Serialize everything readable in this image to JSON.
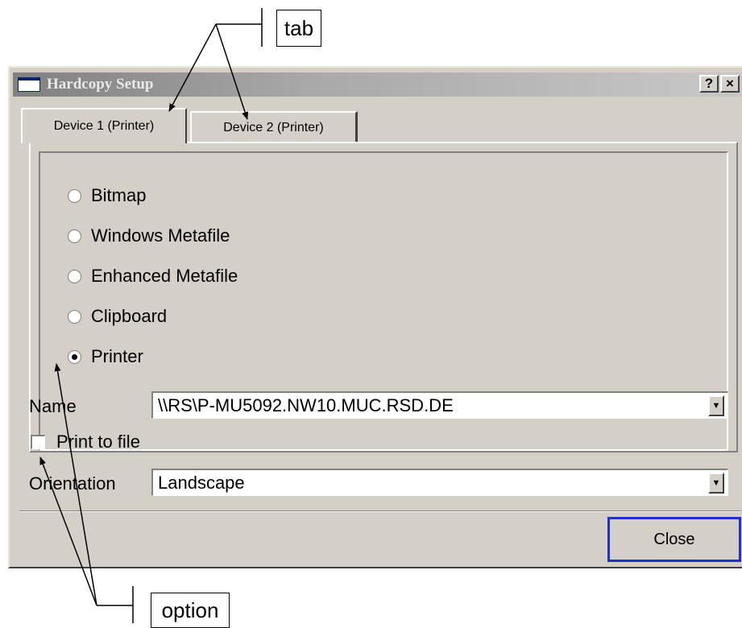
{
  "dialog": {
    "title": "Hardcopy Setup",
    "help_glyph": "?",
    "close_glyph": "×",
    "tabs": [
      {
        "label": "Device 1 (Printer)",
        "active": true
      },
      {
        "label": "Device 2 (Printer)",
        "active": false
      }
    ],
    "output_options": [
      {
        "label": "Bitmap",
        "selected": false
      },
      {
        "label": "Windows Metafile",
        "selected": false
      },
      {
        "label": "Enhanced Metafile",
        "selected": false
      },
      {
        "label": "Clipboard",
        "selected": false
      },
      {
        "label": "Printer",
        "selected": true
      }
    ],
    "name_label": "Name",
    "name_value": "\\\\RS\\P-MU5092.NW10.MUC.RSD.DE",
    "print_to_file_label": "Print to file",
    "print_to_file_checked": false,
    "orientation_label": "Orientation",
    "orientation_value": "Landscape",
    "close_button": "Close"
  },
  "annotations": {
    "tab_callout": "tab",
    "option_callout": "option"
  },
  "icons": {
    "dropdown": "chevron-down-icon",
    "window": "window-icon",
    "help": "help-icon",
    "close": "close-icon"
  },
  "colors": {
    "dialog_bg": "#d4d0c8",
    "focus_border": "#2030c8",
    "titlebar_inactive": "#808080"
  }
}
